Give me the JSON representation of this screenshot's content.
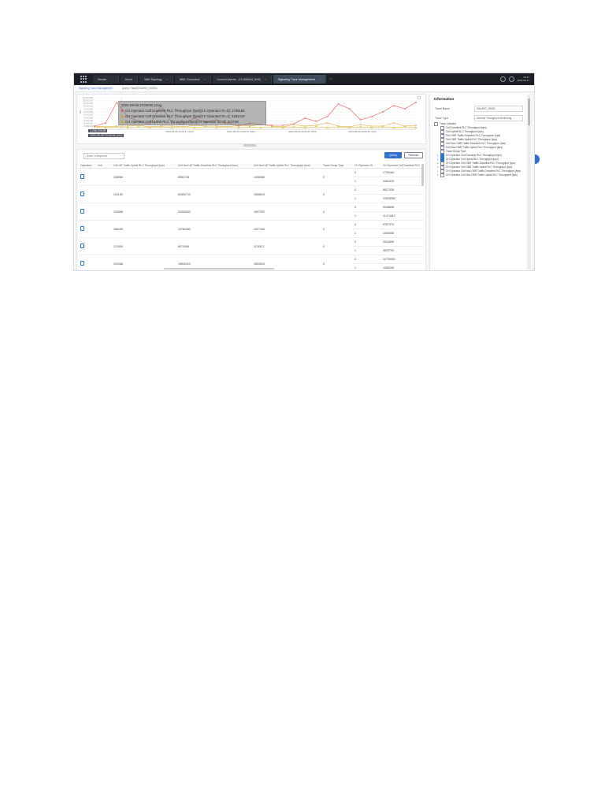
{
  "topbar": {
    "tabs": [
      {
        "label": "Sender",
        "active": false
      },
      {
        "label": "Home",
        "active": false
      },
      {
        "label": "Web Topology",
        "active": false
      },
      {
        "label": "MML Command",
        "active": false
      },
      {
        "label": "Current Alarms - (TLH00A44_5H5)",
        "active": false
      },
      {
        "label": "Signaling Trace Management",
        "active": true
      }
    ],
    "clock_time": "09:27",
    "clock_date": "2024-09-27"
  },
  "subtabs": [
    "Signaling Trace Management",
    "Query Trace(5G&4RO_00004)"
  ],
  "chart": {
    "y_axis_label": "bits",
    "y_ticks": [
      "110,000,000",
      "100,000,000",
      "90,000,000",
      "80,000,000",
      "70,000,000",
      "60,000,000",
      "50,000,000",
      "40,000,000",
      "30,000,000",
      "20,000,000",
      "10,000,000",
      "0"
    ],
    "x_ticks": [
      "2024-09-06 23:09:11 (413)",
      "2024-09-06 23:09:15 (422)",
      "2024-09-06 23:09:21 (413)",
      "2024-09-06 23:09:26 (413)"
    ],
    "tooltip_header": "2024-09-06 23:09:06 (411)",
    "tooltip_rows": [
      {
        "color": "#e05555",
        "text": "CH Operator Cell Downlink RLC Throughput (bps)[CH Operator ID=0]: 1735184"
      },
      {
        "color": "#e0a030",
        "text": "CH Operator Cell Downlink RLC Throughput (bps)[CH Operator ID=1]: 4281419"
      },
      {
        "color": "#c7b400",
        "text": "CH Operator Cell Uplink RLC Throughput (bps)[CH Operator ID=0]: 313748"
      }
    ],
    "date_tag_1": "1,208,204,88",
    "date_tag_2": "2024-09-06 23:09:06 (411)"
  },
  "table": {
    "keyword_placeholder": "Enter a keyword",
    "query_label": "Query",
    "refresh_label": "Refresh",
    "columns": [
      "Operation",
      "Cell",
      "Cell UE Traffic Uplink RLC Throughput (bps)",
      "Cell Non UE Traffic Downlink RLC Throughput (bps)",
      "Cell Non UE Traffic Uplink RLC Throughput (bps)",
      "Trace Group Type",
      "CH Operator ID",
      "CH Operator Cell Downlink RLC"
    ],
    "groups": [
      {
        "uplink": "226080",
        "non_dl": "8062728",
        "non_ul": "1406480",
        "type": "0",
        "rows": [
          {
            "op_id": "0",
            "dl": "1735184"
          },
          {
            "op_id": "1",
            "dl": "4281419"
          }
        ]
      },
      {
        "uplink": "241152",
        "non_dl": "62692712",
        "non_ul": "1658624",
        "type": "0",
        "rows": [
          {
            "op_id": "0",
            "dl": "8517335"
          },
          {
            "op_id": "1",
            "dl": "24528362"
          }
        ]
      },
      {
        "uplink": "226088",
        "non_dl": "20390832",
        "non_ul": "1507000",
        "type": "0",
        "rows": [
          {
            "op_id": "0",
            "dl": "9048808"
          },
          {
            "op_id": "1",
            "dl": "11474612"
          }
        ]
      },
      {
        "uplink": "256160",
        "non_dl": "10781080",
        "non_ul": "1527160",
        "type": "0",
        "rows": [
          {
            "op_id": "0",
            "dl": "9787474"
          },
          {
            "op_id": "1",
            "dl": "1063408"
          }
        ]
      },
      {
        "uplink": "212400",
        "non_dl": "8070408",
        "non_ul": "1135112",
        "type": "0",
        "rows": [
          {
            "op_id": "0",
            "dl": "2041808"
          },
          {
            "op_id": "1",
            "dl": "3833793"
          }
        ]
      },
      {
        "uplink": "231088",
        "non_dl": "19840312",
        "non_ul": "1604515",
        "type": "0",
        "rows": [
          {
            "op_id": "0",
            "dl": "14739061"
          },
          {
            "op_id": "1",
            "dl": "1065208"
          }
        ]
      }
    ]
  },
  "info": {
    "title": "Information",
    "trace_name_label": "Trace Name",
    "trace_name_value": "5G&4RO_00004",
    "trace_type_label": "Trace Type",
    "trace_type_value": "General Throughput Monitoring",
    "tree_root": "Trace Indicator",
    "tree_items": [
      {
        "label": "Cell Downlink RLC Throughput (bps)",
        "checked": false,
        "expandable": false
      },
      {
        "label": "Cell Uplink RLC Throughput (bps)",
        "checked": false,
        "expandable": false
      },
      {
        "label": "Cell GBR Traffic Downlink RLC Throughput (bps)",
        "checked": false,
        "expandable": false
      },
      {
        "label": "Cell GBR Traffic Uplink RLC Throughput (bps)",
        "checked": false,
        "expandable": false
      },
      {
        "label": "Cell Non-GBR Traffic Downlink RLC Throughput (bps)",
        "checked": false,
        "expandable": false
      },
      {
        "label": "Cell Non-GBR Traffic Uplink RLC Throughput (bps)",
        "checked": false,
        "expandable": false
      },
      {
        "label": "Trace Group Type",
        "checked": false,
        "expandable": false
      },
      {
        "label": "CH Operator Cell Downlink RLC Throughput (bps)",
        "checked": true,
        "expandable": true
      },
      {
        "label": "CH Operator Cell Uplink RLC Throughput (bps)",
        "checked": true,
        "expandable": true
      },
      {
        "label": "CH Operator Cell GBR Traffic Downlink RLC Throughput (bps)",
        "checked": false,
        "expandable": true
      },
      {
        "label": "CH Operator Cell GBR Traffic Uplink RLC Throughput (bps)",
        "checked": false,
        "expandable": true
      },
      {
        "label": "CH Operator Cell Non-GBR Traffic Downlink RLC Throughput (bps)",
        "checked": false,
        "expandable": true
      },
      {
        "label": "CH Operator Cell Non-GBR Traffic Uplink RLC Throughput (bps)",
        "checked": false,
        "expandable": true
      }
    ]
  },
  "colors": {
    "accent": "#2f6fd0",
    "series_dl_op0": "#e05555",
    "series_dl_op1": "#e0a030",
    "series_ul": "#c7b400"
  }
}
